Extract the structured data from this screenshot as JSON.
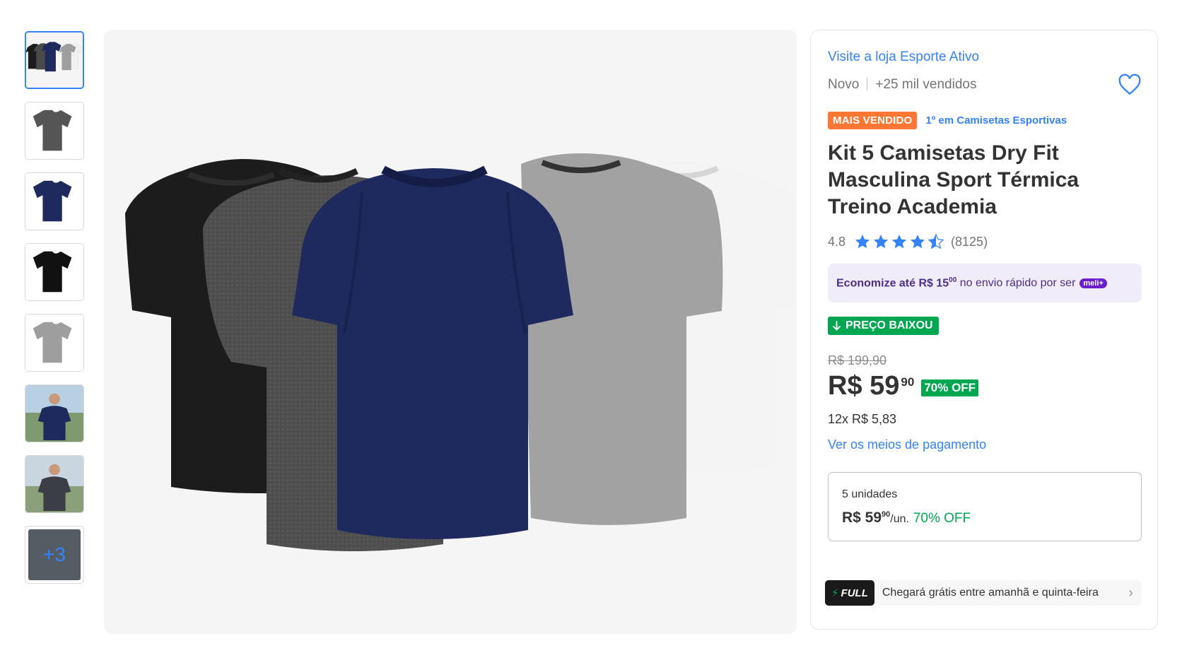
{
  "gallery": {
    "thumbnails": [
      {
        "name": "kit-5-camisetas",
        "active": true
      },
      {
        "name": "camiseta-cinza-mescla"
      },
      {
        "name": "camiseta-azul-marinho"
      },
      {
        "name": "camiseta-preta"
      },
      {
        "name": "camiseta-cinza"
      },
      {
        "name": "modelo-camiseta-azul"
      },
      {
        "name": "modelo-camiseta-cinza"
      }
    ],
    "more_label": "+3",
    "shirt_colors": [
      "#1c1c1c",
      "#4a4a4a",
      "#1e2a5e",
      "#9e9e9e",
      "#f4f4f4"
    ]
  },
  "panel": {
    "store_link": "Visite a loja Esporte Ativo",
    "condition": "Novo",
    "sold": "+25 mil vendidos",
    "badge": "MAIS VENDIDO",
    "ranking_link": "1º em Camisetas Esportivas",
    "title": "Kit 5 Camisetas Dry Fit Masculina Sport Térmica Treino Academia",
    "rating": "4.8",
    "rating_value": 4.8,
    "rating_count": "(8125)",
    "promo": {
      "prefix": "Economize até R$ 15",
      "cents": "00",
      "suffix": " no envio rápido por ser",
      "brand": "meli+"
    },
    "price_drop": "PREÇO BAIXOU",
    "old_price": "R$ 199,90",
    "price": "R$ 59",
    "price_cents": "90",
    "discount": "70% OFF",
    "installments": "12x R$ 5,83",
    "payment_link": "Ver os meios de pagamento",
    "quantity": {
      "label": "5 unidades",
      "price": "R$ 59",
      "cents": "90",
      "unit": "/un.",
      "discount": "70% OFF"
    },
    "shipping": {
      "badge": "FULL",
      "text": "Chegará grátis entre amanhã e quinta-feira"
    }
  },
  "colors": {
    "accent": "#3483fa",
    "green": "#00a650",
    "orange": "#ff7733"
  }
}
